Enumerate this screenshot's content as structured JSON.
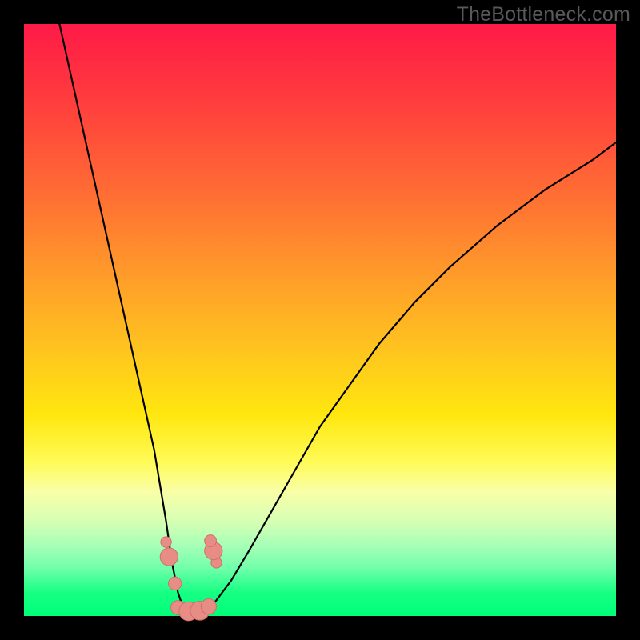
{
  "watermark": "TheBottleneck.com",
  "colors": {
    "background": "#000000",
    "gradient_top": "#ff1a47",
    "gradient_bottom": "#00ff7a",
    "curve": "#000000",
    "marker_fill": "#e88d86",
    "marker_stroke": "#cf6f68"
  },
  "chart_data": {
    "type": "line",
    "title": "",
    "xlabel": "",
    "ylabel": "",
    "xlim": [
      0,
      100
    ],
    "ylim": [
      0,
      100
    ],
    "grid": false,
    "series": [
      {
        "name": "left-curve",
        "x": [
          6,
          8,
          10,
          12,
          14,
          16,
          18,
          20,
          22,
          24,
          25,
          26,
          27,
          28
        ],
        "y": [
          100,
          91,
          82,
          73,
          64,
          55,
          46,
          37,
          28,
          16,
          9,
          4,
          1,
          0
        ]
      },
      {
        "name": "right-curve",
        "x": [
          28,
          30,
          32,
          35,
          38,
          42,
          46,
          50,
          55,
          60,
          66,
          72,
          80,
          88,
          96,
          100
        ],
        "y": [
          0,
          0.5,
          2,
          6,
          11,
          18,
          25,
          32,
          39,
          46,
          53,
          59,
          66,
          72,
          77,
          80
        ]
      }
    ],
    "markers": [
      {
        "x": 24.0,
        "y": 12.5,
        "r": 0.9
      },
      {
        "x": 24.5,
        "y": 10.0,
        "r": 1.5
      },
      {
        "x": 25.5,
        "y": 5.5,
        "r": 1.1
      },
      {
        "x": 32.5,
        "y": 9.0,
        "r": 0.9
      },
      {
        "x": 32.0,
        "y": 11.0,
        "r": 1.5
      },
      {
        "x": 31.5,
        "y": 12.7,
        "r": 1.0
      },
      {
        "x": 26.0,
        "y": 1.4,
        "r": 1.2
      },
      {
        "x": 27.8,
        "y": 0.8,
        "r": 1.6
      },
      {
        "x": 29.7,
        "y": 0.9,
        "r": 1.6
      },
      {
        "x": 31.2,
        "y": 1.6,
        "r": 1.3
      }
    ]
  }
}
